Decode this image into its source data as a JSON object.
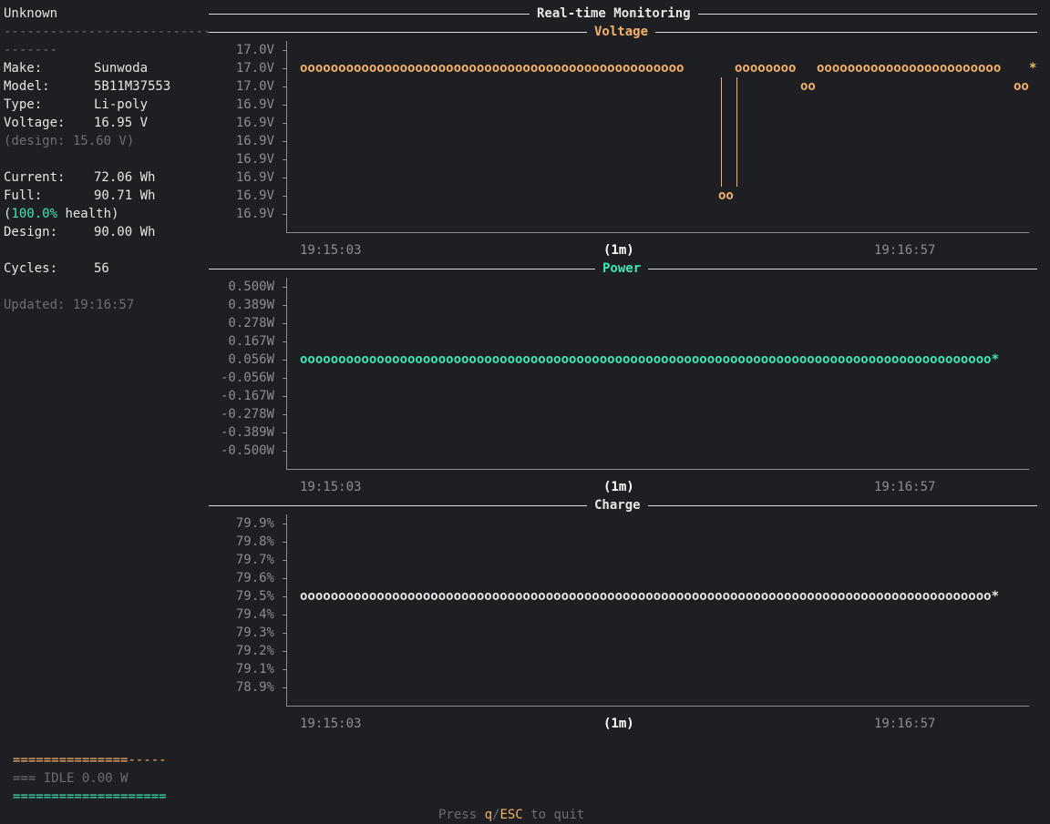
{
  "sidebar": {
    "title": "Unknown",
    "divider1": "-----------------------------",
    "divider2": "-------",
    "make_label": "Make:",
    "make_value": "Sunwoda",
    "model_label": "Model:",
    "model_value": "5B11M37553",
    "type_label": "Type:",
    "type_value": "Li-poly",
    "voltage_label": "Voltage:",
    "voltage_value": "16.95 V",
    "design_voltage": "(design: 15.60 V)",
    "current_label": "Current:",
    "current_value": "72.06 Wh",
    "full_label": "Full:",
    "full_value": "90.71 Wh",
    "health_open": "(",
    "health_pct": "100.0%",
    "health_rest": " health)",
    "design_label": "Design:",
    "design_value": "90.00 Wh",
    "cycles_label": "Cycles:",
    "cycles_value": "56",
    "updated": "Updated: 19:16:57"
  },
  "header": {
    "title": "Real-time Monitoring"
  },
  "voltage_chart": {
    "title": "Voltage",
    "y_ticks": [
      "17.0V",
      "17.0V",
      "17.0V",
      "16.9V",
      "16.9V",
      "16.9V",
      "16.9V",
      "16.9V",
      "16.9V",
      "16.9V"
    ],
    "x_start": "19:15:03",
    "x_center": "(1m)",
    "x_end": "19:16:57",
    "seg1": "oooooooooooooooooooooooooooooooooooooooooooooooooo",
    "seg2": "oooooooo",
    "seg3": "oooooooooooooooooooooooo",
    "low1": "oo",
    "low2": "oo",
    "low3": "oo",
    "tip": "*"
  },
  "power_chart": {
    "title": "Power",
    "y_ticks": [
      "0.500W",
      "0.389W",
      "0.278W",
      "0.167W",
      "0.056W",
      "-0.056W",
      "-0.167W",
      "-0.278W",
      "-0.389W",
      "-0.500W"
    ],
    "x_start": "19:15:03",
    "x_center": "(1m)",
    "x_end": "19:16:57",
    "series": "oooooooooooooooooooooooooooooooooooooooooooooooooooooooooooooooooooooooooooooooooooooooooo*"
  },
  "charge_chart": {
    "title": "Charge",
    "y_ticks": [
      "79.9%",
      "79.8%",
      "79.7%",
      "79.6%",
      "79.5%",
      "79.4%",
      "79.3%",
      "79.2%",
      "79.1%",
      "78.9%"
    ],
    "x_start": "19:15:03",
    "x_center": "(1m)",
    "x_end": "19:16:57",
    "series": "oooooooooooooooooooooooooooooooooooooooooooooooooooooooooooooooooooooooooooooooooooooooooo*"
  },
  "bars": {
    "charge_filled": "===============",
    "charge_empty": "-----",
    "status": "=== IDLE 0.00 W",
    "health_bar": "===================="
  },
  "footer": {
    "press": "Press ",
    "q": "q",
    "slash": "/",
    "esc": "ESC",
    "quit": " to quit"
  },
  "colors": {
    "background": "#1e1f22",
    "orange": "#f5b26b",
    "green": "#3ee6b8",
    "dim": "#6b6e75"
  }
}
